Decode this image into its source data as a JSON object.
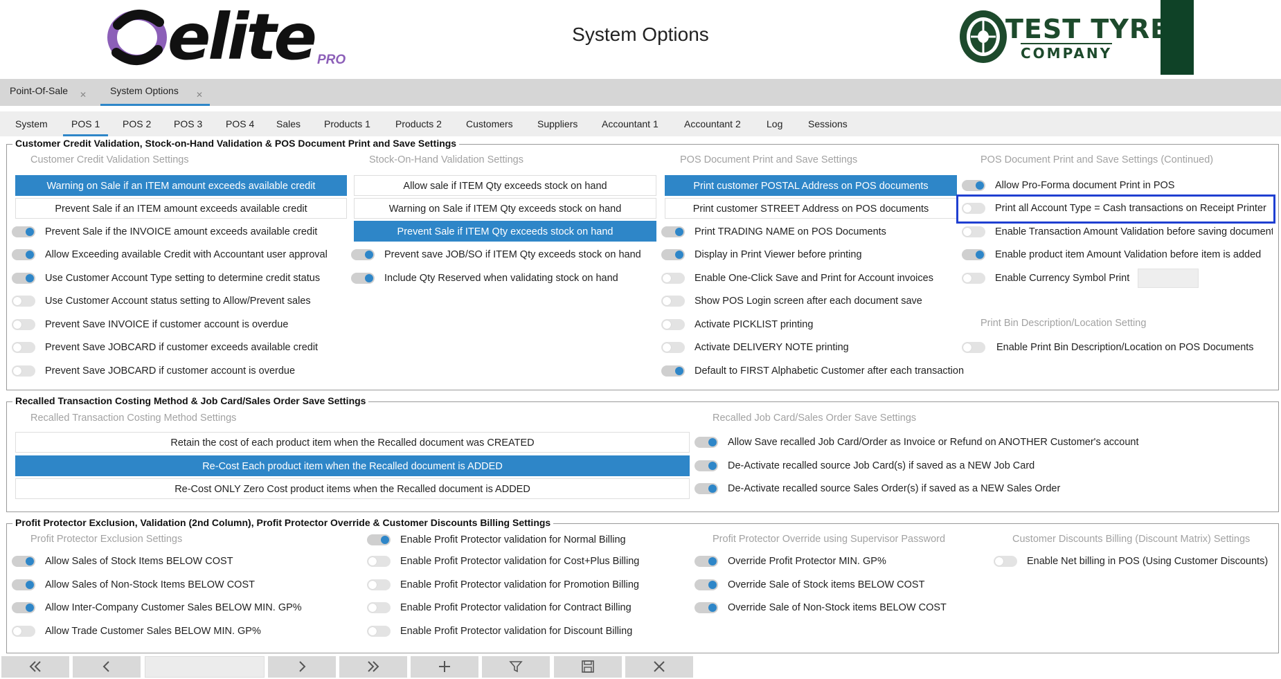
{
  "header": {
    "brand_name": "elite",
    "brand_suffix": "PRO",
    "title": "System Options",
    "company_line1": "TEST TYRE",
    "company_line2": "COMPANY"
  },
  "doc_tabs": [
    {
      "label": "Point-Of-Sale",
      "active": false
    },
    {
      "label": "System Options",
      "active": true
    }
  ],
  "sub_tabs": [
    {
      "label": "System",
      "active": false
    },
    {
      "label": "POS 1",
      "active": true
    },
    {
      "label": "POS 2",
      "active": false
    },
    {
      "label": "POS 3",
      "active": false
    },
    {
      "label": "POS 4",
      "active": false
    },
    {
      "label": "Sales",
      "active": false
    },
    {
      "label": "Products 1",
      "active": false
    },
    {
      "label": "Products 2",
      "active": false
    },
    {
      "label": "Customers",
      "active": false
    },
    {
      "label": "Suppliers",
      "active": false
    },
    {
      "label": "Accountant 1",
      "active": false
    },
    {
      "label": "Accountant 2",
      "active": false
    },
    {
      "label": "Log",
      "active": false
    },
    {
      "label": "Sessions",
      "active": false
    }
  ],
  "group1": {
    "title": "Customer Credit Validation, Stock-on-Hand Validation & POS Document Print and Save Settings",
    "col1": {
      "label": "Customer Credit Validation Settings",
      "buttons": [
        {
          "label": "Warning on Sale if an ITEM amount exceeds available credit",
          "selected": true
        },
        {
          "label": "Prevent Sale if an ITEM amount exceeds available credit",
          "selected": false
        }
      ],
      "options": [
        {
          "label": "Prevent Sale if the INVOICE amount exceeds available credit",
          "on": true
        },
        {
          "label": "Allow Exceeding available Credit with Accountant user approval",
          "on": true
        },
        {
          "label": "Use Customer Account Type setting to determine credit status",
          "on": true
        },
        {
          "label": "Use Customer Account status setting to Allow/Prevent sales",
          "on": false
        },
        {
          "label": "Prevent Save INVOICE if customer account is overdue",
          "on": false
        },
        {
          "label": "Prevent Save JOBCARD if customer exceeds available credit",
          "on": false
        },
        {
          "label": "Prevent Save JOBCARD if customer account is overdue",
          "on": false
        }
      ]
    },
    "col2": {
      "label": "Stock-On-Hand Validation Settings",
      "buttons": [
        {
          "label": "Allow sale if ITEM Qty exceeds stock on hand",
          "selected": false
        },
        {
          "label": "Warning on Sale if ITEM Qty exceeds stock on hand",
          "selected": false
        },
        {
          "label": "Prevent Sale if ITEM Qty exceeds stock on hand",
          "selected": true
        }
      ],
      "options": [
        {
          "label": "Prevent save JOB/SO if ITEM Qty exceeds stock on hand",
          "on": true
        },
        {
          "label": "Include Qty Reserved when validating stock on hand",
          "on": true
        }
      ]
    },
    "col3": {
      "label": "POS Document Print and Save Settings",
      "buttons": [
        {
          "label": "Print customer POSTAL Address on POS documents",
          "selected": true
        },
        {
          "label": "Print customer STREET Address on POS documents",
          "selected": false
        }
      ],
      "options": [
        {
          "label": "Print TRADING NAME on POS Documents",
          "on": true
        },
        {
          "label": "Display in Print Viewer before printing",
          "on": true
        },
        {
          "label": "Enable One-Click Save and Print for Account invoices",
          "on": false
        },
        {
          "label": "Show POS Login screen after each document save",
          "on": false
        },
        {
          "label": "Activate PICKLIST printing",
          "on": false
        },
        {
          "label": "Activate DELIVERY NOTE printing",
          "on": false
        },
        {
          "label": "Default to FIRST Alphabetic Customer after each transaction",
          "on": true
        }
      ]
    },
    "col4": {
      "label": "POS Document Print and Save Settings (Continued)",
      "options": [
        {
          "label": "Allow Pro-Forma document Print in POS",
          "on": true
        },
        {
          "label": "Print all Account Type = Cash transactions on Receipt Printer",
          "on": false
        },
        {
          "label": "Enable Transaction Amount Validation before saving documents",
          "on": false
        },
        {
          "label": "Enable product item Amount Validation before item is added",
          "on": true
        },
        {
          "label": "Enable Currency Symbol Print",
          "on": false
        }
      ],
      "bin_label": "Print Bin Description/Location Setting",
      "bin_option": {
        "label": "Enable Print Bin Description/Location on POS Documents",
        "on": false
      }
    }
  },
  "group2": {
    "title": "Recalled Transaction Costing Method & Job Card/Sales Order Save Settings",
    "col1": {
      "label": "Recalled Transaction Costing Method Settings",
      "buttons": [
        {
          "label": "Retain the cost of each product item when the Recalled document was CREATED",
          "selected": false
        },
        {
          "label": "Re-Cost Each product item when the Recalled document is ADDED",
          "selected": true
        },
        {
          "label": "Re-Cost ONLY Zero Cost product items when the Recalled document is ADDED",
          "selected": false
        }
      ]
    },
    "col2": {
      "label": "Recalled Job Card/Sales Order Save Settings",
      "options": [
        {
          "label": "Allow Save recalled Job Card/Order as Invoice or Refund on ANOTHER Customer's account",
          "on": true
        },
        {
          "label": "De-Activate recalled source Job Card(s) if saved as a NEW Job Card",
          "on": true
        },
        {
          "label": "De-Activate recalled source Sales Order(s) if saved as a NEW Sales Order",
          "on": true
        }
      ]
    }
  },
  "group3": {
    "title": "Profit Protector Exclusion, Validation (2nd Column), Profit Protector Override & Customer Discounts Billing Settings",
    "col1": {
      "label": "Profit Protector Exclusion Settings",
      "options": [
        {
          "label": "Allow Sales of Stock Items BELOW COST",
          "on": true
        },
        {
          "label": "Allow Sales of Non-Stock Items BELOW COST",
          "on": true
        },
        {
          "label": "Allow Inter-Company Customer Sales BELOW MIN. GP%",
          "on": true
        },
        {
          "label": "Allow Trade Customer Sales BELOW MIN. GP%",
          "on": false
        }
      ]
    },
    "col2": {
      "options": [
        {
          "label": "Enable Profit Protector validation for Normal Billing",
          "on": true
        },
        {
          "label": "Enable Profit Protector validation for Cost+Plus Billing",
          "on": false
        },
        {
          "label": "Enable Profit Protector validation for Promotion Billing",
          "on": false
        },
        {
          "label": "Enable Profit Protector validation for Contract Billing",
          "on": false
        },
        {
          "label": "Enable Profit Protector validation for Discount Billing",
          "on": false
        }
      ]
    },
    "col3": {
      "label": "Profit Protector Override using Supervisor Password",
      "options": [
        {
          "label": "Override Profit Protector MIN. GP%",
          "on": true
        },
        {
          "label": "Override Sale of Stock items BELOW COST",
          "on": true
        },
        {
          "label": "Override Sale of Non-Stock items BELOW COST",
          "on": true
        }
      ]
    },
    "col4": {
      "label": "Customer Discounts Billing (Discount Matrix) Settings",
      "options": [
        {
          "label": "Enable Net billing in POS (Using Customer Discounts)",
          "on": false
        }
      ]
    }
  },
  "nav": {
    "icons": [
      "double-chevron-left-icon",
      "chevron-left-icon",
      "chevron-right-icon",
      "double-chevron-right-icon",
      "plus-icon",
      "filter-icon",
      "save-icon",
      "close-icon"
    ]
  },
  "colors": {
    "accent": "#2e86c8",
    "highlight": "#1f3fd1",
    "brand_purple": "#8c5fb8",
    "brand_green": "#0f4227"
  }
}
